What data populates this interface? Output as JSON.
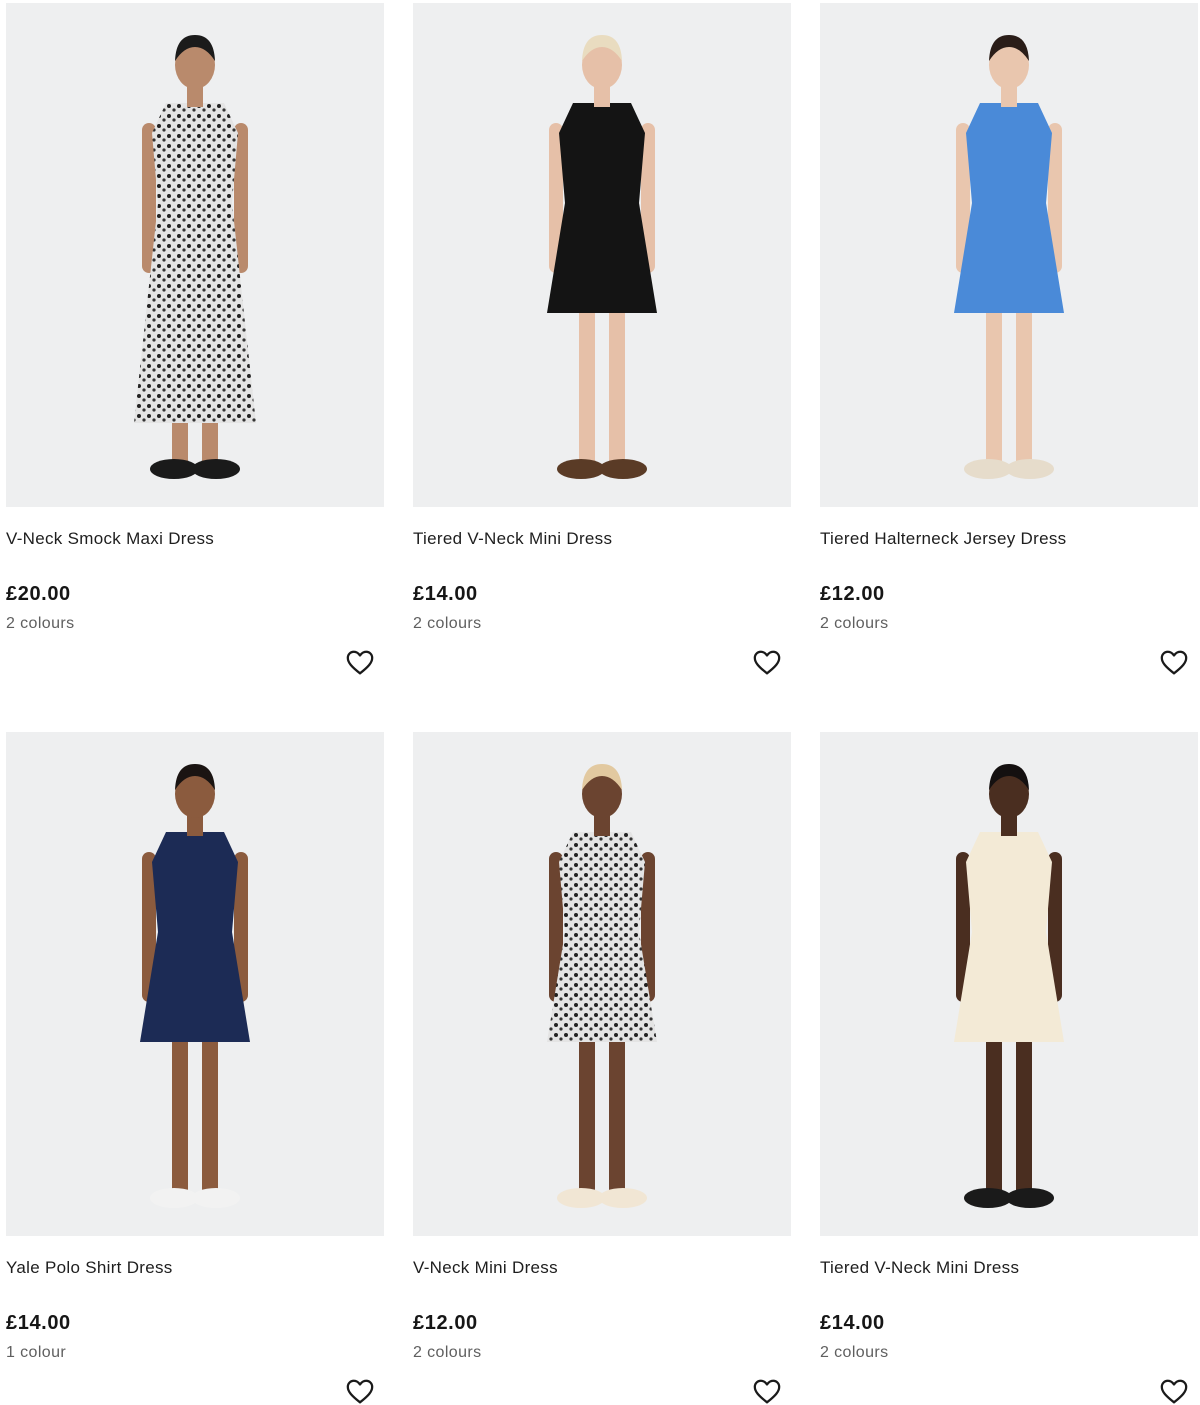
{
  "products": [
    {
      "name": "V-Neck Smock Maxi Dress",
      "price": "£20.00",
      "colours": "2 colours",
      "dress_color": "#8e8e8e",
      "pattern": "print-dark",
      "skin": "#b98a6c",
      "hair": "#1b1b1b",
      "shoes": "#1a1a1a",
      "length": "maxi"
    },
    {
      "name": "Tiered V-Neck Mini Dress",
      "price": "£14.00",
      "colours": "2 colours",
      "dress_color": "#141414",
      "pattern": "solid",
      "skin": "#e6c0a8",
      "hair": "#e9dcc0",
      "shoes": "#5a3b26",
      "length": "mini"
    },
    {
      "name": "Tiered Halterneck Jersey Dress",
      "price": "£12.00",
      "colours": "2 colours",
      "dress_color": "#4a8ad8",
      "pattern": "solid",
      "skin": "#e9c6ae",
      "hair": "#2a1d18",
      "shoes": "#e6dccb",
      "length": "mini"
    },
    {
      "name": "Yale Polo Shirt Dress",
      "price": "£14.00",
      "colours": "1 colour",
      "dress_color": "#1c2b55",
      "pattern": "solid",
      "skin": "#8b5b3e",
      "hair": "#1a1412",
      "shoes": "#f2f2f2",
      "length": "mini"
    },
    {
      "name": "V-Neck Mini Dress",
      "price": "£12.00",
      "colours": "2 colours",
      "dress_color": "#4ec39b",
      "pattern": "print-light",
      "skin": "#6b4430",
      "hair": "#e2c9a0",
      "shoes": "#f1e6d4",
      "length": "mini"
    },
    {
      "name": "Tiered V-Neck Mini Dress",
      "price": "£14.00",
      "colours": "2 colours",
      "dress_color": "#f3ead6",
      "pattern": "solid",
      "skin": "#4a2e20",
      "hair": "#141010",
      "shoes": "#1a1a1a",
      "length": "mini"
    }
  ],
  "wishlist_icon": "heart-outline-icon"
}
